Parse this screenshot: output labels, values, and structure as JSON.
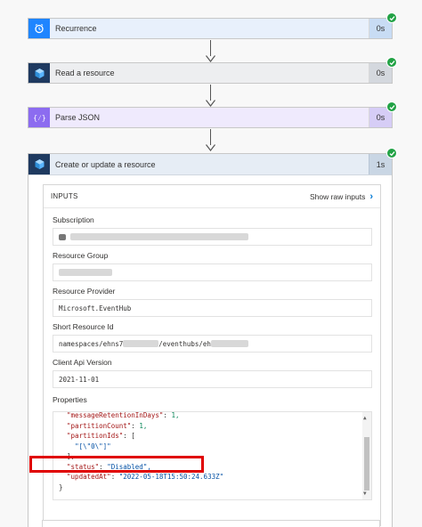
{
  "steps": [
    {
      "title": "Recurrence",
      "duration": "0s",
      "icon": "alarm-clock-icon",
      "icon_color": "#1f85ff",
      "bg": "#e8f0fc",
      "dur_bg": "#c8dcf4"
    },
    {
      "title": "Read a resource",
      "duration": "0s",
      "icon": "cube-icon",
      "icon_color": "#1f3a60",
      "bg": "#edeef0",
      "dur_bg": "#d4d8de"
    },
    {
      "title": "Parse JSON",
      "duration": "0s",
      "icon": "curly-braces-icon",
      "icon_color": "#8c6cf0",
      "bg": "#efeafd",
      "dur_bg": "#d6cdf6"
    }
  ],
  "active_step": {
    "title": "Create or update a resource",
    "duration": "1s",
    "icon": "cube-icon"
  },
  "inputs": {
    "header": "INPUTS",
    "show_raw": "Show raw inputs",
    "fields": [
      {
        "label": "Subscription",
        "value": ""
      },
      {
        "label": "Resource Group",
        "value": ""
      },
      {
        "label": "Resource Provider",
        "value": "Microsoft.EventHub"
      },
      {
        "label": "Short Resource Id",
        "value_prefix": "namespaces/ehns7",
        "value_mid": "/eventhubs/eh",
        "value_suffix": ""
      },
      {
        "label": "Client Api Version",
        "value": "2021-11-01"
      }
    ],
    "properties_label": "Properties",
    "properties_lines": [
      {
        "key": "\"messageRetentionInDays\"",
        "sep": ": ",
        "val": "1,",
        "vtype": "n",
        "indent": "  "
      },
      {
        "key": "\"partitionCount\"",
        "sep": ": ",
        "val": "1,",
        "vtype": "n",
        "indent": "  "
      },
      {
        "key": "\"partitionIds\"",
        "sep": ": ",
        "val": "[",
        "vtype": "p",
        "indent": "  "
      },
      {
        "key": "",
        "sep": "",
        "val": "\"[\\\"0\\\"]\"",
        "vtype": "s",
        "indent": "    "
      },
      {
        "key": "",
        "sep": "",
        "val": "],",
        "vtype": "p",
        "indent": "  "
      },
      {
        "key": "\"status\"",
        "sep": ": ",
        "val": "\"Disabled\",",
        "vtype": "s",
        "indent": "  "
      },
      {
        "key": "\"updatedAt\"",
        "sep": ": ",
        "val": "\"2022-05-18T15:50:24.633Z\"",
        "vtype": "s",
        "indent": "  "
      },
      {
        "key": "",
        "sep": "",
        "val": "}",
        "vtype": "p",
        "indent": ""
      }
    ]
  },
  "colors": {
    "success": "#22a245",
    "accent": "#0078d4",
    "highlight": "#e00000"
  }
}
